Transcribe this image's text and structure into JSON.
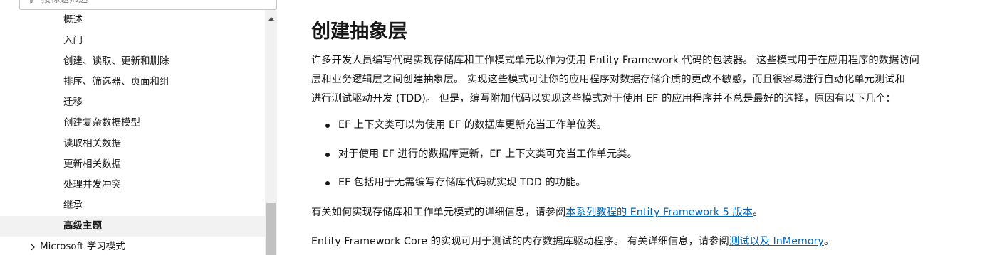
{
  "sidebar": {
    "filter_placeholder": "按标题筛选",
    "items": [
      {
        "label": "概述"
      },
      {
        "label": "入门"
      },
      {
        "label": "创建、读取、更新和删除"
      },
      {
        "label": "排序、筛选器、页面和组"
      },
      {
        "label": "迁移"
      },
      {
        "label": "创建复杂数据模型"
      },
      {
        "label": "读取相关数据"
      },
      {
        "label": "更新相关数据"
      },
      {
        "label": "处理并发冲突"
      },
      {
        "label": "继承"
      },
      {
        "label": "高级主题",
        "active": true
      }
    ],
    "parent_item": {
      "label": "Microsoft 学习模式"
    }
  },
  "article": {
    "title": "创建抽象层",
    "intro_lines": [
      "许多开发人员编写代码实现存储库和工作模式单元以作为使用 Entity Framework 代码的包装器。 这些模式用于在应用程序的数据访问",
      "层和业务逻辑层之间创建抽象层。 实现这些模式可让你的应用程序对数据存储介质的更改不敏感，而且很容易进行自动化单元测试和",
      "进行测试驱动开发 (TDD)。 但是，编写附加代码以实现这些模式对于使用 EF 的应用程序并不总是最好的选择，原因有以下几个："
    ],
    "bullets": [
      "EF 上下文类可以为使用 EF 的数据库更新充当工作单位类。",
      "对于使用 EF 进行的数据库更新，EF 上下文类可充当工作单元类。",
      "EF 包括用于无需编写存储库代码就实现 TDD 的功能。"
    ],
    "para1": {
      "before": "有关如何实现存储库和工作单元模式的详细信息，请参阅",
      "link": "本系列教程的 Entity Framework 5 版本",
      "after": "。"
    },
    "para2": {
      "before": "Entity Framework Core 的实现可用于测试的内存数据库驱动程序。 有关详细信息，请参阅",
      "link": "测试以及 InMemory",
      "after": "。"
    }
  }
}
